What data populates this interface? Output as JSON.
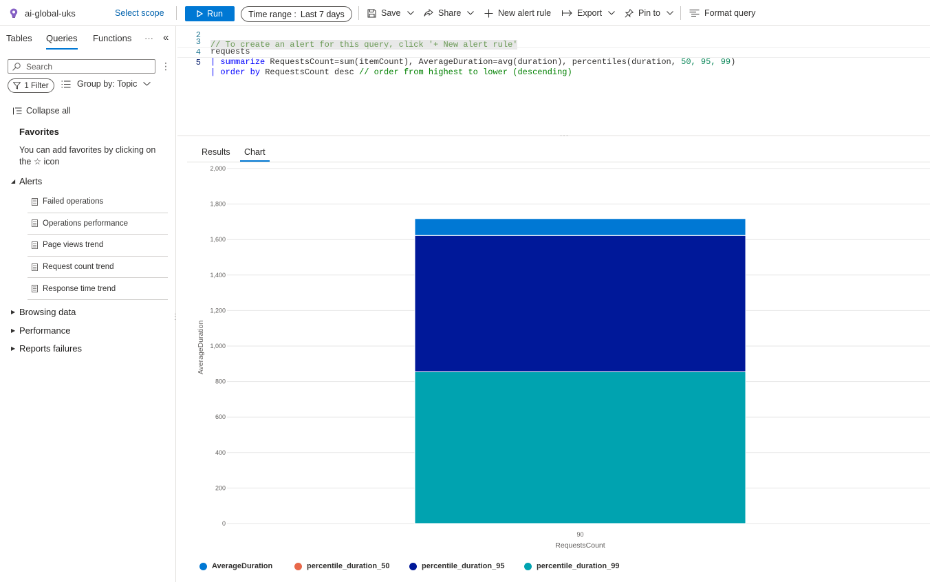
{
  "toolbar": {
    "scope_name": "ai-global-uks",
    "select_scope": "Select scope",
    "run": "Run",
    "time_range_label": "Time range :",
    "time_range_value": "Last 7 days",
    "save": "Save",
    "share": "Share",
    "new_alert_rule": "New alert rule",
    "export": "Export",
    "pin_to": "Pin to",
    "format_query": "Format query"
  },
  "left_panel": {
    "tabs": [
      "Tables",
      "Queries",
      "Functions"
    ],
    "active_tab": "Queries",
    "more": "···",
    "collapse_panel": "«",
    "search_placeholder": "Search",
    "filter": "1 Filter",
    "group_by": "Group by: Topic",
    "collapse_all": "Collapse all",
    "favorites_title": "Favorites",
    "favorites_hint": "You can add favorites by clicking on the ☆ icon",
    "groups": {
      "alerts": "Alerts",
      "browsing": "Browsing data",
      "performance": "Performance",
      "reports": "Reports failures"
    },
    "alert_items": [
      "Failed operations",
      "Operations performance",
      "Page views trend",
      "Request count trend",
      "Response time trend"
    ]
  },
  "editor": {
    "lines": [
      {
        "n": "2",
        "text": "// To create an alert for this query, click '+ New alert rule'"
      },
      {
        "n": "3",
        "text": "requests"
      },
      {
        "n": "4",
        "pipe": "| ",
        "kw": "summarize",
        "rest": " RequestsCount=sum(itemCount), AverageDuration=avg(duration), percentiles(duration, ",
        "nums": "50, 95, 99",
        "tail": ")"
      },
      {
        "n": "5",
        "pipe": "| ",
        "kw": "order by",
        "rest": " RequestsCount desc ",
        "cmt": "// order from highest to lower (descending)"
      }
    ]
  },
  "results": {
    "tabs": [
      "Results",
      "Chart"
    ],
    "active_tab": "Chart"
  },
  "chart_data": {
    "type": "bar",
    "stacked": true,
    "categories": [
      "90"
    ],
    "series": [
      {
        "name": "AverageDuration",
        "values": [
          95
        ],
        "color": "#0078d4"
      },
      {
        "name": "percentile_duration_50",
        "values": [
          0
        ],
        "color": "#e8684a"
      },
      {
        "name": "percentile_duration_95",
        "values": [
          768
        ],
        "color": "#001899"
      },
      {
        "name": "percentile_duration_99",
        "values": [
          855
        ],
        "color": "#00a3b0"
      }
    ],
    "stack_order": [
      "percentile_duration_99",
      "percentile_duration_95",
      "percentile_duration_50",
      "AverageDuration"
    ],
    "xlabel": "RequestsCount",
    "ylabel": "AverageDuration",
    "ylim": [
      0,
      2000
    ],
    "yticks": [
      0,
      200,
      400,
      600,
      800,
      1000,
      1200,
      1400,
      1600,
      1800,
      2000
    ],
    "ytick_labels": [
      "0",
      "200",
      "400",
      "600",
      "800",
      "1,000",
      "1,200",
      "1,400",
      "1,600",
      "1,800",
      "2,000"
    ],
    "grid": true,
    "legend_position": "bottom-left"
  }
}
